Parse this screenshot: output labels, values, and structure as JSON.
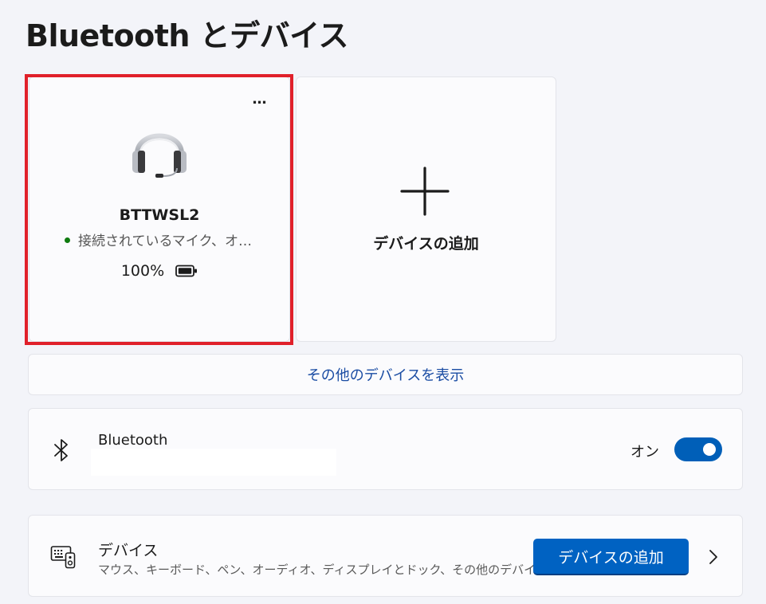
{
  "page": {
    "title": "Bluetooth とデバイス"
  },
  "device_tile": {
    "name": "BTTWSL2",
    "status": "接続されているマイク、オ…",
    "battery": "100%",
    "more_label": "…",
    "icon": "headset-icon",
    "battery_icon": "battery-full-icon",
    "status_color": "#0f7b0f",
    "highlight_color": "#e0202a"
  },
  "add_tile": {
    "label": "デバイスの追加",
    "icon": "plus-icon"
  },
  "more_devices": {
    "label": "その他のデバイスを表示"
  },
  "bluetooth": {
    "label": "Bluetooth",
    "state": "オン",
    "enabled": true,
    "icon": "bluetooth-icon",
    "accent": "#005fb8"
  },
  "devices": {
    "label": "デバイス",
    "description": "マウス、キーボード、ペン、オーディオ、ディスプレイとドック、その他のデバイス",
    "button_label": "デバイスの追加",
    "icon": "devices-icon",
    "accent": "#0062c2"
  }
}
